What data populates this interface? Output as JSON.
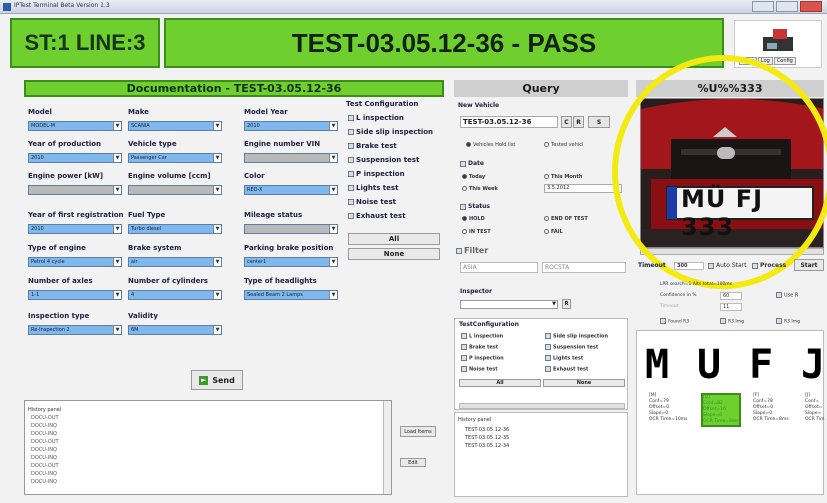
{
  "window": {
    "title": "IPTest Terminal Beta Version 1.3"
  },
  "station": {
    "label": "ST:1 LINE:3"
  },
  "result": {
    "text": "TEST-03.05.12-36 - PASS"
  },
  "logo_tabs": [
    "View",
    "Log",
    "Config"
  ],
  "documentation": {
    "title": "Documentation - TEST-03.05.12-36",
    "fields": [
      {
        "label": "Model",
        "value": "MODEL-M"
      },
      {
        "label": "Make",
        "value": "SCANIA"
      },
      {
        "label": "Model Year",
        "value": "2010"
      },
      {
        "label": "Year of production",
        "value": "2010"
      },
      {
        "label": "Vehicle type",
        "value": "Passenger Car"
      },
      {
        "label": "Engine number VIN",
        "value": ""
      },
      {
        "label": "Engine power [kW]",
        "value": ""
      },
      {
        "label": "Engine volume [ccm]",
        "value": ""
      },
      {
        "label": "Color",
        "value": "RED-X"
      },
      {
        "label": "Year of first registration",
        "value": "2010"
      },
      {
        "label": "Fuel Type",
        "value": "Turbo diesel"
      },
      {
        "label": "Mileage status",
        "value": ""
      },
      {
        "label": "Type of engine",
        "value": "Petrol 4 cycle"
      },
      {
        "label": "Brake system",
        "value": "air"
      },
      {
        "label": "Parking brake position",
        "value": "center1"
      },
      {
        "label": "Number of axles",
        "value": "1-1"
      },
      {
        "label": "Number of cylinders",
        "value": "4"
      },
      {
        "label": "Type of headlights",
        "value": "Sealed Beam 2 Lamps"
      },
      {
        "label": "Inspection type",
        "value": "Re-Inspection 2"
      },
      {
        "label": "Validity",
        "value": "6M"
      }
    ],
    "send_label": "Send",
    "history_title": "History panel",
    "history": [
      "DOCU-OUT",
      "DOCU-INQ",
      "DOCU-INQ",
      "DOCU-OUT",
      "DOCU-INQ",
      "DOCU-INQ",
      "DOCU-OUT",
      "DOCU-INQ",
      "DOCU-INQ"
    ],
    "load_items_label": "Load Items",
    "edit_label": "Edit"
  },
  "test_config": {
    "title": "Test Configuration",
    "items": [
      "L inspection",
      "Side slip inspection",
      "Brake test",
      "Suspension test",
      "P inspection",
      "Lights test",
      "Noise test",
      "Exhaust test"
    ],
    "all_label": "All",
    "none_label": "None"
  },
  "query": {
    "title": "Query",
    "new_vehicle_label": "New Vehicle",
    "input_value": "TEST-03.05.12-36",
    "btn_c": "C",
    "btn_r": "R",
    "btn_s": "S",
    "radio_hold": "Vehicles Hold list",
    "radio_tested": "Tested vehicl",
    "date_label": "Date",
    "today": "Today",
    "this_month": "This Month",
    "this_week": "This Week",
    "date_value": "3.5.2012",
    "status_label": "Status",
    "hold": "HOLD",
    "end_of_test": "END OF TEST",
    "in_test": "IN TEST",
    "fail": "FAIL",
    "filter_label": "Filter",
    "filter1": "ASIA",
    "filter2": "ROCSTA",
    "inspector_label": "Inspector",
    "inspector_btn": "R",
    "tc_title": "TestConfiguration",
    "tc_left": [
      "L inspection",
      "Brake test",
      "P inspection",
      "Noise test"
    ],
    "tc_right": [
      "Side slip inspection",
      "Suspension test",
      "Lights test",
      "Exhaust test"
    ],
    "tc_all": "All",
    "tc_none": "None",
    "hist_title": "History panel",
    "hist_items": [
      "TEST-03.05.12-36",
      "TEST-03.05.12-35",
      "TEST-03.05.12-34"
    ]
  },
  "camera": {
    "title": "%U%%333",
    "plate_text": "MÜ FJ 333",
    "timeout_label": "Timeout",
    "timeout_value": "300",
    "auto_start": "Auto Start",
    "process": "Process",
    "start": "Start",
    "lpr_search": "LPR search=1 Alts total=100ms",
    "confidence_label": "Confidence in %",
    "confidence_value": "60",
    "use_label": "Use R",
    "timeout2": "Timeout",
    "timeout2_value": "11",
    "check1": "Found R3",
    "check2": "R3 Img",
    "check3": "R3 Img"
  },
  "ocr": {
    "chars": [
      "M",
      "U",
      "F",
      "J"
    ],
    "info": [
      "[M]\nConf=79\nOffset=0\nSlope=0\nOCR Time=10ms",
      "[U]\nConf=82\nOffset=16\nSlope=0\nOCR Time=8ms",
      "[F]\nConf=78\nOffset=0\nSlope=0\nOCR Time=8ms",
      "[J]\nConf=\nOffset=\nSlope=\nOCR Tim"
    ]
  },
  "colors": {
    "pass_green": "#6fcf2e",
    "select_blue": "#7fb8ec",
    "highlight_yellow": "#f3ea12"
  }
}
